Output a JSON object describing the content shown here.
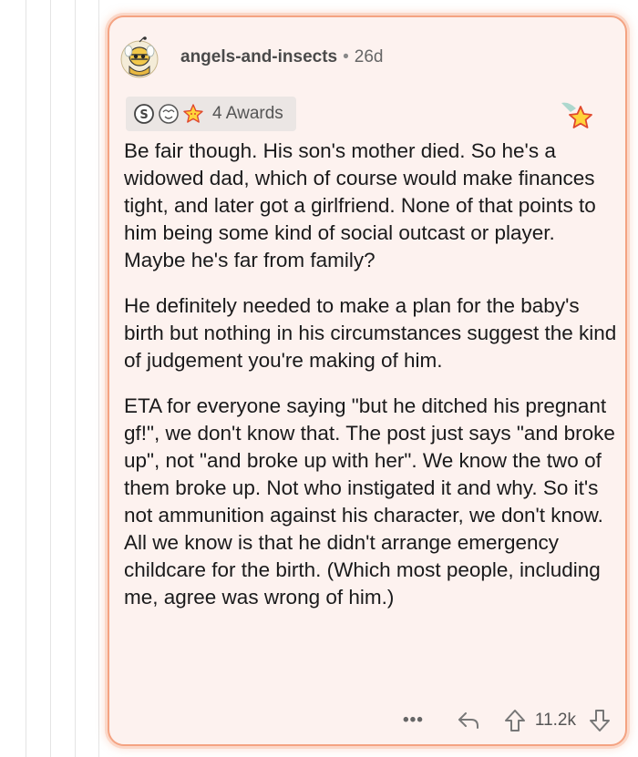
{
  "comment": {
    "username": "angels-and-insects",
    "separator": "•",
    "age": "26d",
    "awards": {
      "icons": [
        "silver-award-icon",
        "wholesome-award-icon",
        "starstruck-award-icon"
      ],
      "count_label": "4 Awards"
    },
    "corner_award_icon": "star-award-icon",
    "paragraphs": [
      "Be fair though. His son's mother died. So he's a widowed dad, which of course would make finances tight, and later got a girlfriend. None of that points to him being some kind of social outcast or player. Maybe he's far from family?",
      "He definitely needed to make a plan for the baby's birth but nothing in his circumstances suggest the kind of judgement you're making of him.",
      "ETA for everyone saying \"but he ditched his pregnant gf!\", we don't know that. The post just says \"and broke up\", not \"and broke up with her\". We know the two of them broke up. Not who instigated it and why. So it's not ammunition against his character, we don't know. All we know is that he didn't arrange emergency childcare for the birth. (Which most people, including me, agree was wrong of him.)"
    ],
    "footer": {
      "more_label": "•••",
      "score": "11.2k"
    }
  },
  "colors": {
    "card_border": "#f4a382",
    "card_background": "#fdf2ef",
    "awards_background": "#ebe6e4"
  }
}
